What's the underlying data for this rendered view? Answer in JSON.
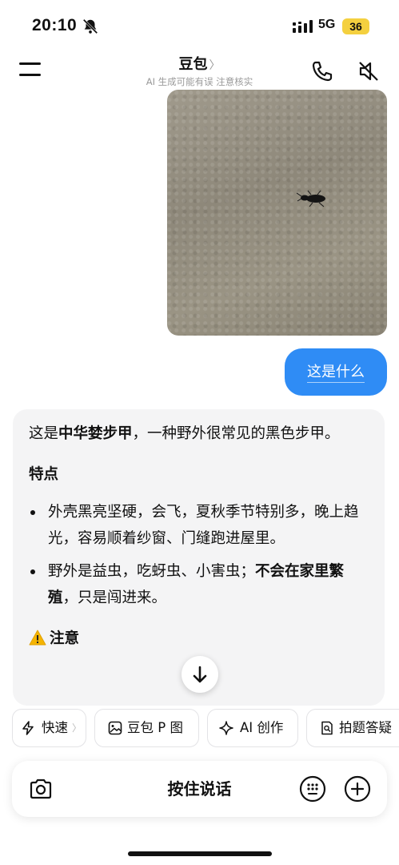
{
  "status_bar": {
    "time": "20:10",
    "network": "5G",
    "battery": "36"
  },
  "header": {
    "title": "豆包",
    "title_chevron": "〉",
    "subtitle": "AI 生成可能有误 注意核实"
  },
  "chat": {
    "user_message": "这是什么",
    "ai_response": {
      "intro_prefix": "这是",
      "intro_bold": "中华婪步甲",
      "intro_suffix": "，一种野外很常见的黑色步甲。",
      "section_title": "特点",
      "bullets": [
        {
          "text": "外壳黑亮坚硬，会飞，夏秋季节特别多，晚上趋光，容易顺着纱窗、门缝跑进屋里。"
        },
        {
          "prefix": "野外是益虫，吃蚜虫、小害虫；",
          "bold": "不会在家里繁殖",
          "suffix": "，只是闯进来。"
        }
      ],
      "warning_title": "注意"
    }
  },
  "chips": [
    {
      "label": "快速",
      "icon": "lightning-icon",
      "chevron": "〉"
    },
    {
      "label": "豆包 P 图",
      "icon": "image-edit-icon"
    },
    {
      "label": "AI 创作",
      "icon": "sparkle-icon"
    },
    {
      "label": "拍题答疑",
      "icon": "question-scan-icon"
    }
  ],
  "input_bar": {
    "voice_label": "按住说话"
  },
  "colors": {
    "user_bubble": "#2f8cf5",
    "ai_bubble": "#f4f4f5",
    "battery": "#f4d03f"
  }
}
